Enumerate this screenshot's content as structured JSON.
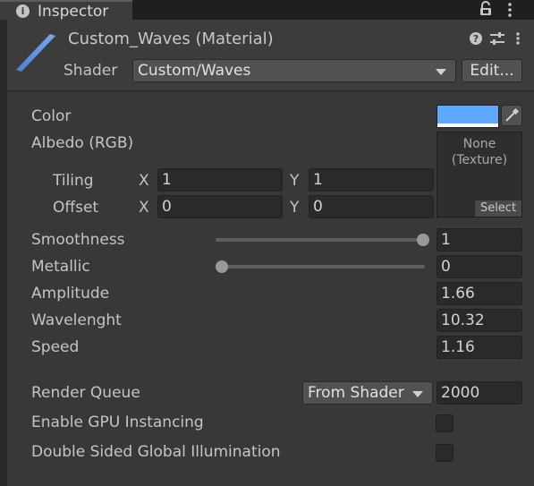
{
  "tab": {
    "title": "Inspector",
    "icon": "info-icon"
  },
  "header": {
    "material_name": "Custom_Waves (Material)",
    "shader_label": "Shader",
    "shader_value": "Custom/Waves",
    "edit_label": "Edit..."
  },
  "properties": {
    "color_label": "Color",
    "color_value": "#5fa8ff",
    "albedo_label": "Albedo (RGB)",
    "texture_none": "None",
    "texture_type": "(Texture)",
    "texture_select": "Select",
    "tiling_label": "Tiling",
    "tiling_x_label": "X",
    "tiling_x": "1",
    "tiling_y_label": "Y",
    "tiling_y": "1",
    "offset_label": "Offset",
    "offset_x_label": "X",
    "offset_x": "0",
    "offset_y_label": "Y",
    "offset_y": "0",
    "smoothness_label": "Smoothness",
    "smoothness_value": "1",
    "metallic_label": "Metallic",
    "metallic_value": "0",
    "amplitude_label": "Amplitude",
    "amplitude_value": "1.66",
    "wavelength_label": "Wavelenght",
    "wavelength_value": "10.32",
    "speed_label": "Speed",
    "speed_value": "1.16"
  },
  "advanced": {
    "render_queue_label": "Render Queue",
    "render_queue_mode": "From Shader",
    "render_queue_value": "2000",
    "gpu_instancing_label": "Enable GPU Instancing",
    "double_sided_gi_label": "Double Sided Global Illumination"
  }
}
